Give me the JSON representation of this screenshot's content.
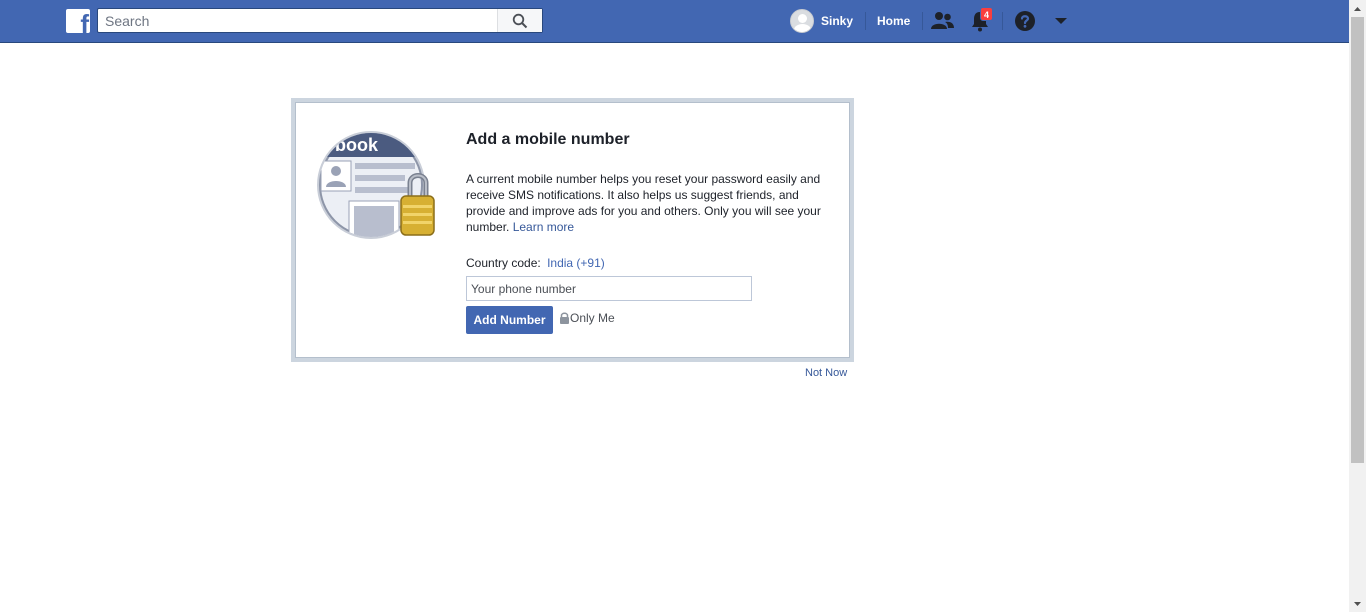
{
  "header": {
    "logo_letter": "f",
    "search": {
      "placeholder": "Search",
      "value": ""
    },
    "user_name": "Sinky",
    "home_label": "Home",
    "notifications_count": "4",
    "colors": {
      "bar": "#4267b2",
      "badge": "#fa3e3e"
    },
    "icons": [
      "facebook-logo-icon",
      "search-icon",
      "friend-requests-icon",
      "notifications-icon",
      "help-icon",
      "account-menu-caret-icon"
    ]
  },
  "card": {
    "title": "Add a mobile number",
    "description": "A current mobile number helps you reset your password easily and receive SMS notifications. It also helps us suggest friends, and provide and improve ads for you and others. Only you will see your number.",
    "learn_more": "Learn more",
    "illustration_text": "book",
    "country_code_label": "Country code:",
    "country_code_value": "India (+91)",
    "phone_placeholder": "Your phone number",
    "phone_value": "",
    "add_button": "Add Number",
    "privacy_label": "Only Me"
  },
  "not_now": "Not Now"
}
